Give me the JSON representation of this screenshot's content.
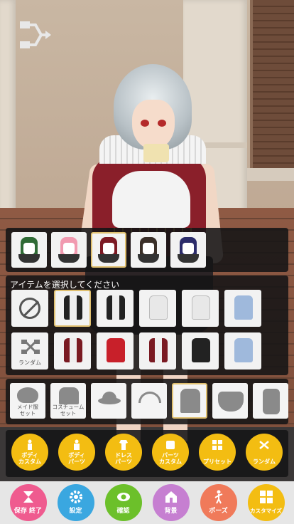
{
  "item_section": {
    "title": "アイテムを選択してください",
    "random_label": "ランダム"
  },
  "categories": {
    "maid_head_label": "メイド服\nセット",
    "costume_set_label": "コスチューム\nセット"
  },
  "main_buttons": [
    {
      "label": "ボディ\nカスタム"
    },
    {
      "label": "ボディ\nパーツ"
    },
    {
      "label": "ドレス\nパーツ"
    },
    {
      "label": "パーツ\nカスタム"
    },
    {
      "label": "プリセット"
    },
    {
      "label": "ランダム"
    }
  ],
  "bottom_bar": [
    {
      "label": "保存 終了",
      "color": "#ef5b8f"
    },
    {
      "label": "設定",
      "color": "#3aa7e0"
    },
    {
      "label": "確認",
      "color": "#6cc02a"
    },
    {
      "label": "背景",
      "color": "#c67fd1"
    },
    {
      "label": "ポーズ",
      "color": "#f07a5a"
    },
    {
      "label": "カスタマイズ",
      "color": "#f3bd12"
    }
  ],
  "color_variants": [
    "#2f6a35",
    "#f19ab0",
    "#7c1a24",
    "#3a2f28",
    "#2c2c6a"
  ],
  "accent": "#e0c070"
}
